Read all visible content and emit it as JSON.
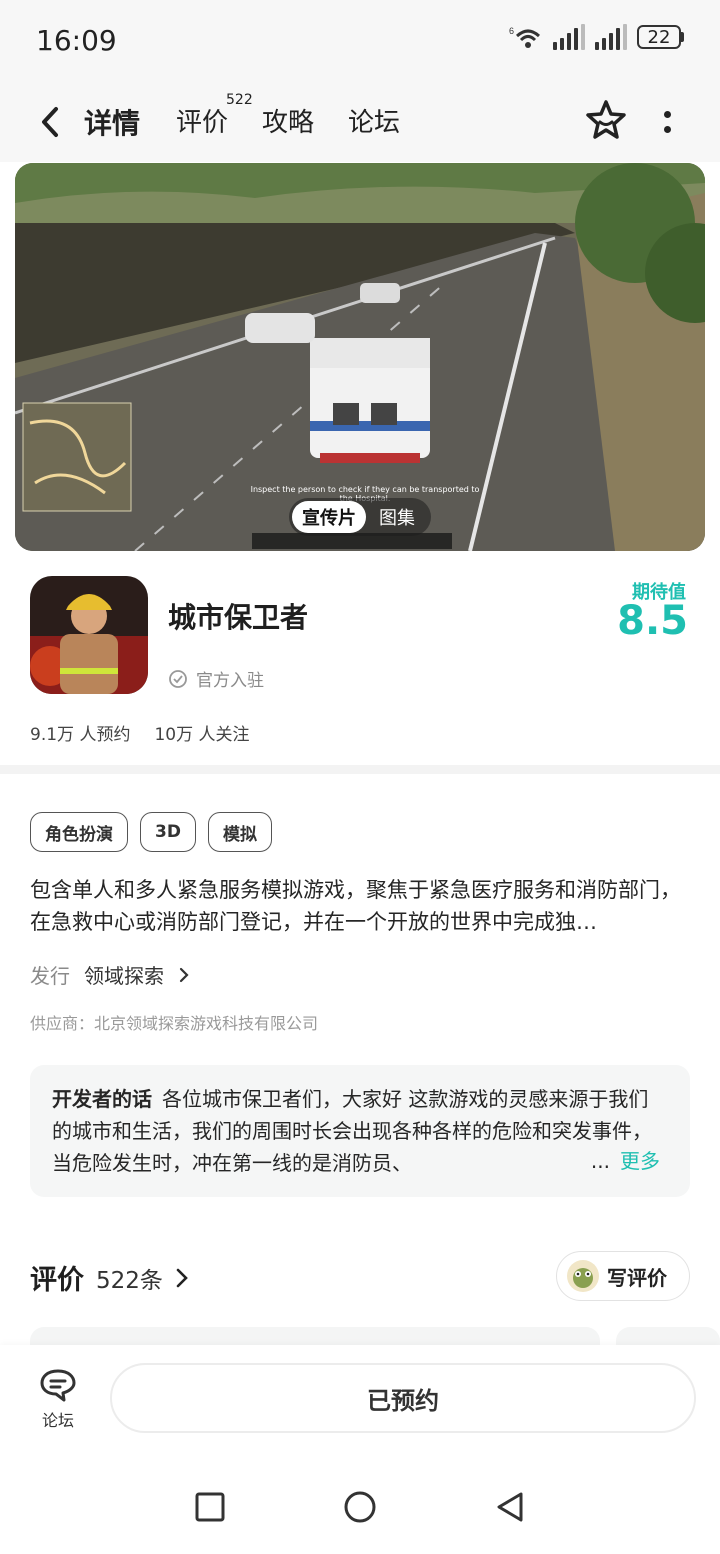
{
  "status_bar": {
    "time": "16:09",
    "battery": "22",
    "wifi_badge": "6"
  },
  "nav": {
    "tabs": [
      {
        "label": "详情"
      },
      {
        "label": "评价"
      },
      {
        "label": "攻略"
      },
      {
        "label": "论坛"
      }
    ],
    "review_badge": "522"
  },
  "hero": {
    "caption": "Inspect the person to check if they can be transported to the Hospital.",
    "toggle": [
      "宣传片",
      "图集"
    ]
  },
  "app": {
    "title": "城市保卫者",
    "official": "官方入驻",
    "expect_label": "期待值",
    "expect_score": "8.5",
    "stats": [
      "9.1万 人预约",
      "10万 人关注"
    ]
  },
  "tags": [
    "角色扮演",
    "3D",
    "模拟"
  ],
  "description": "包含单人和多人紧急服务模拟游戏，聚焦于紧急医疗服务和消防部门，在急救中心或消防部门登记，并在一个开放的世界中完成独…",
  "publisher": {
    "label": "发行",
    "name": "领域探索"
  },
  "supplier": "供应商：北京领域探索游戏科技有限公司",
  "developer": {
    "label": "开发者的话",
    "text": "各位城市保卫者们，大家好 这款游戏的灵感来源于我们的城市和生活，我们的周围时长会出现各种各样的危险和突发事件，当危险发生时，冲在第一线的是消防员、",
    "ellipsis": "...",
    "more": "更多"
  },
  "reviews": {
    "title": "评价",
    "count": "522条",
    "write": "写评价"
  },
  "bottom": {
    "forum": "论坛",
    "reserved": "已预约"
  },
  "colors": {
    "accent": "#1fbfb1",
    "tab_underline": "#2ad4c5"
  }
}
